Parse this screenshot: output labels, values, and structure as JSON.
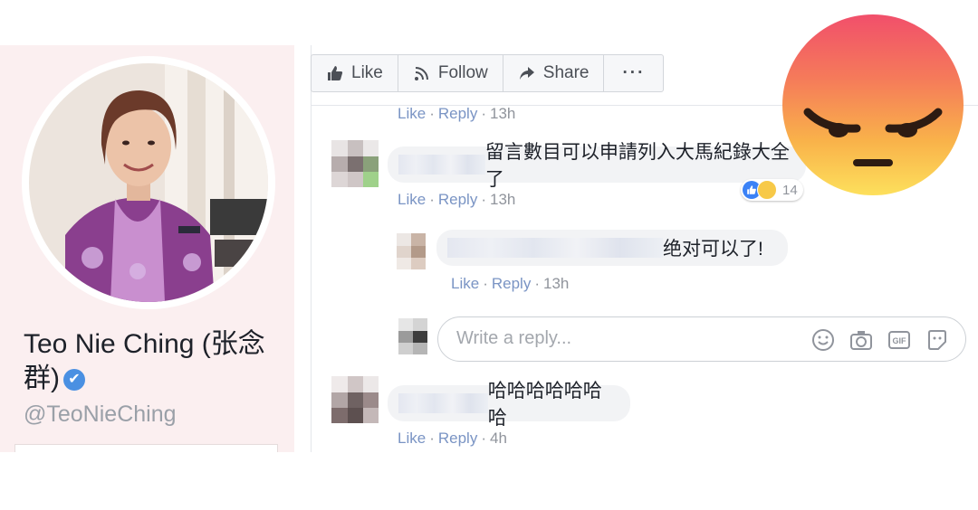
{
  "profile": {
    "name": "Teo Nie Ching (张念群)",
    "verified_mark": "✔",
    "handle": "@TeoNieChing"
  },
  "actions": [
    {
      "label": "Like",
      "icon": "thumbs-up-icon"
    },
    {
      "label": "Follow",
      "icon": "rss-icon"
    },
    {
      "label": "Share",
      "icon": "share-arrow-icon"
    },
    {
      "label": "···",
      "icon": "more-icon"
    }
  ],
  "comments": {
    "top_meta": {
      "like": "Like",
      "reply": "Reply",
      "time": "13h"
    },
    "c1": {
      "text": "留言數目可以申請列入大馬紀錄大全了",
      "like": "Like",
      "reply": "Reply",
      "time": "13h",
      "reaction_count": "14",
      "reactions": [
        "like",
        "haha"
      ]
    },
    "r1": {
      "text": "绝对可以了!",
      "like": "Like",
      "reply": "Reply",
      "time": "13h"
    },
    "reply_box": {
      "placeholder": "Write a reply..."
    },
    "c2": {
      "text": "哈哈哈哈哈哈哈",
      "like": "Like",
      "reply": "Reply",
      "time": "4h"
    }
  },
  "colors": {
    "link": "#7a94c4",
    "verified": "#4a90e2",
    "angry_top": "#f14f6b",
    "angry_bottom": "#fde05c"
  },
  "overlay": {
    "emoji": "angry-face-icon"
  }
}
